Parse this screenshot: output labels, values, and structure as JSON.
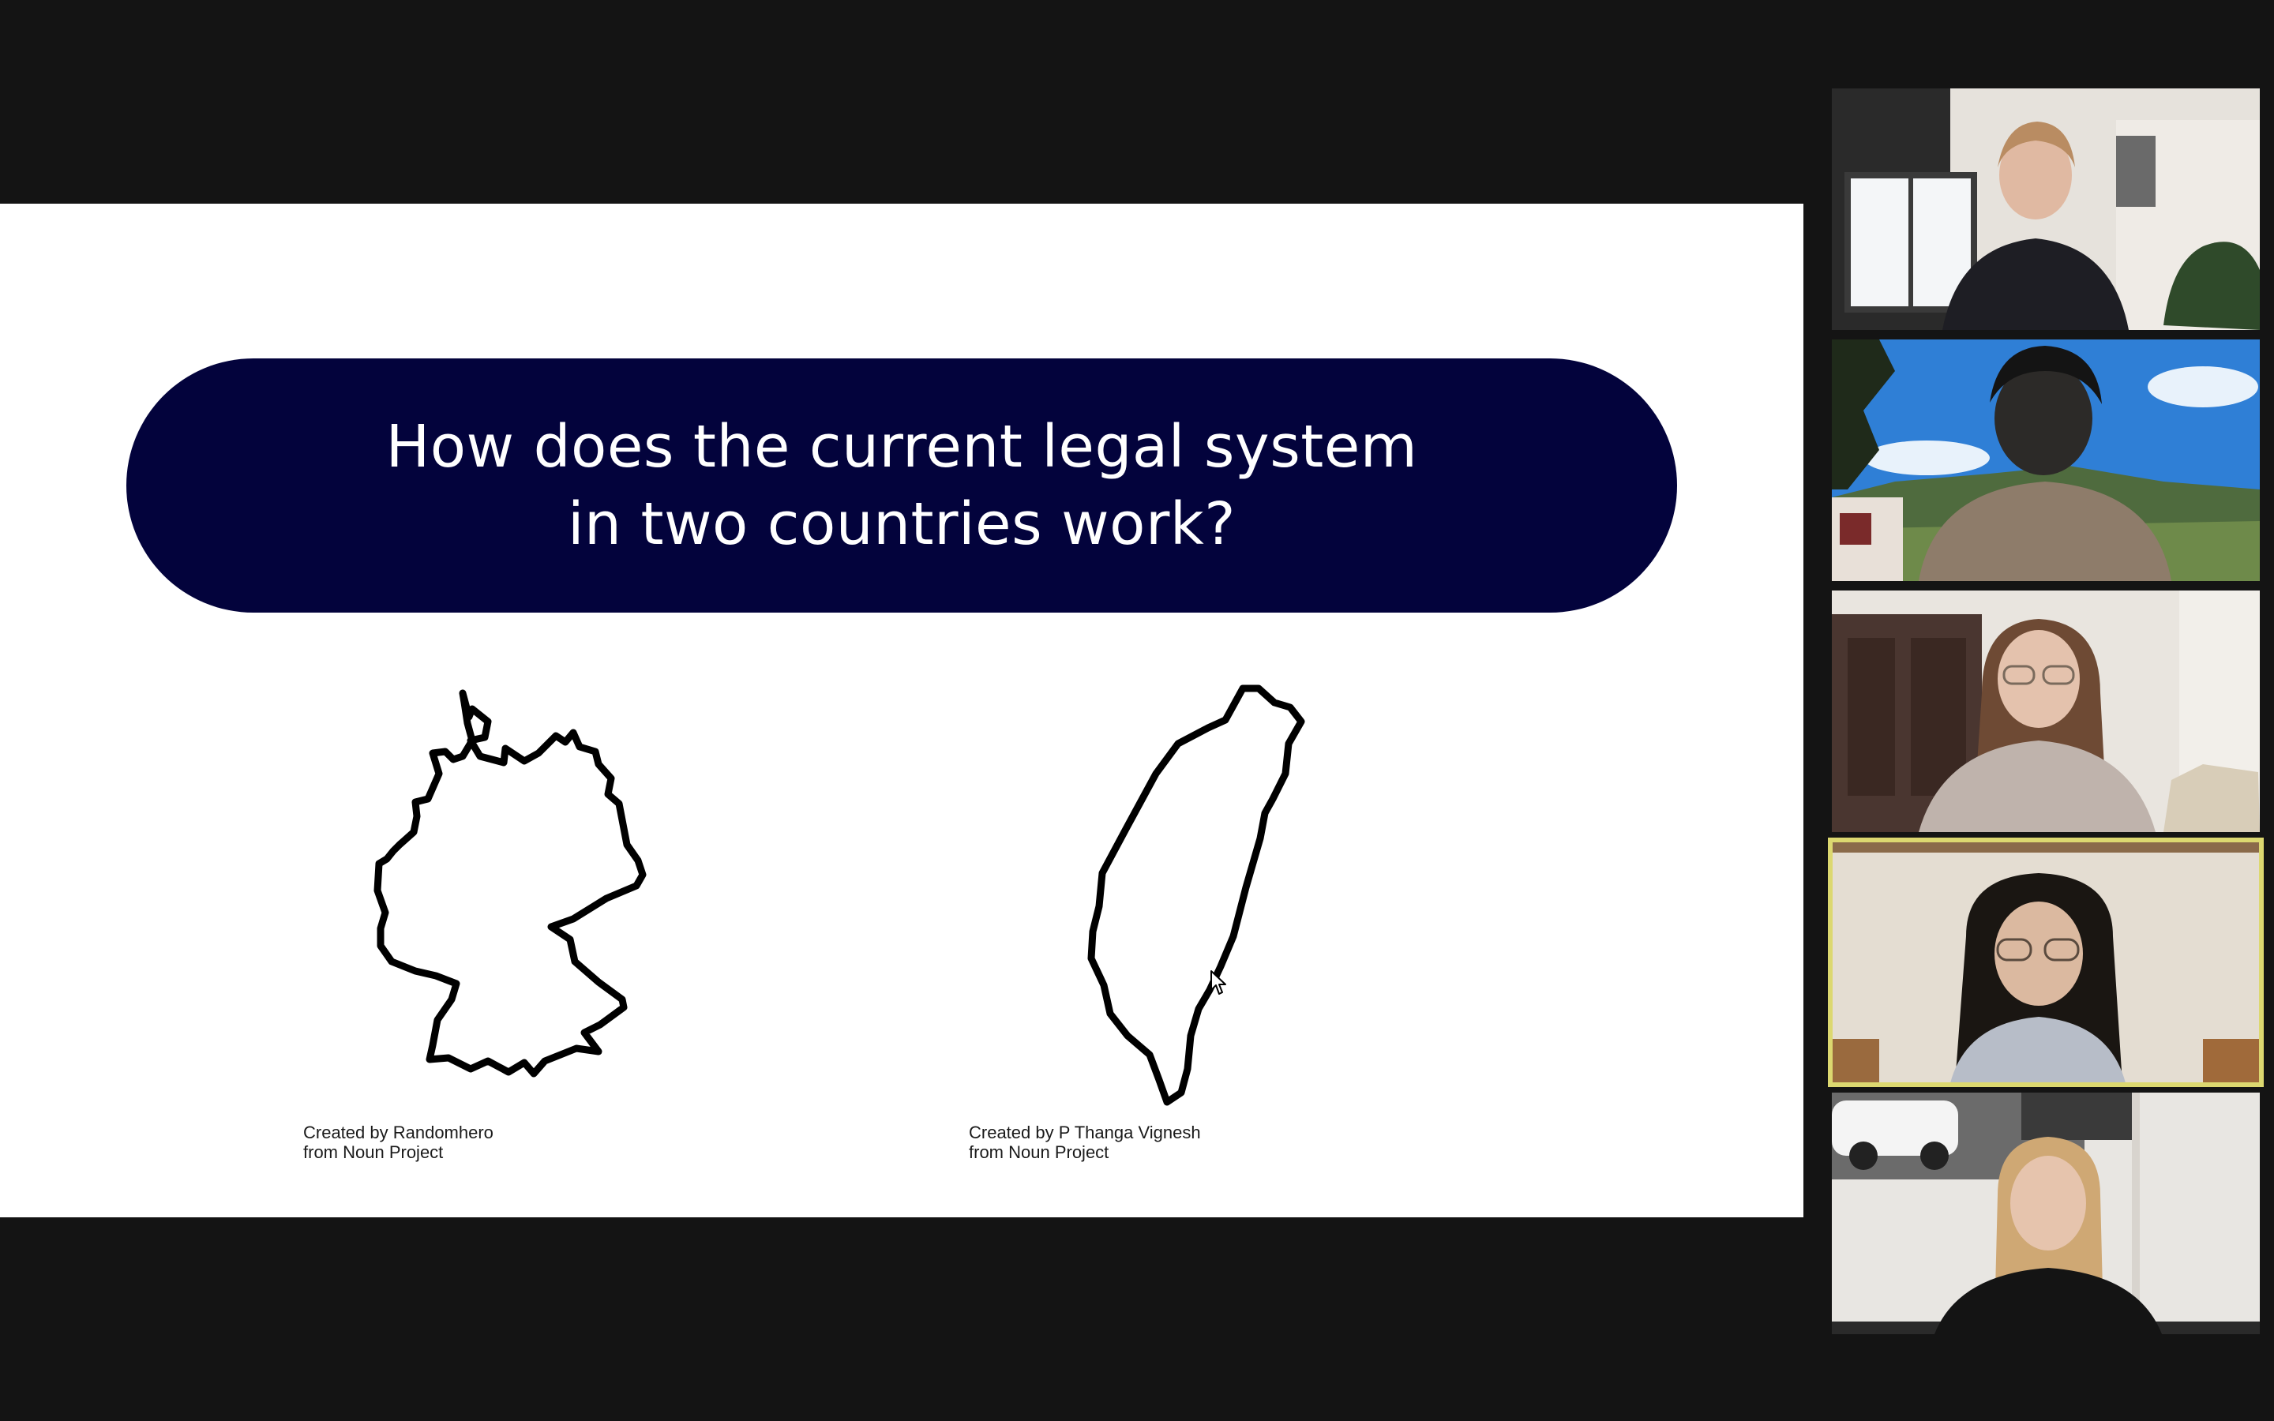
{
  "slide": {
    "title_line1": "How does the current legal system",
    "title_line2": "in two countries work?",
    "maps": [
      {
        "icon": "germany-outline-icon",
        "credit_line1": "Created by Randomhero",
        "credit_line2": "from Noun Project"
      },
      {
        "icon": "taiwan-outline-icon",
        "credit_line1": "Created by P Thanga Vignesh",
        "credit_line2": "from Noun Project"
      }
    ]
  },
  "gallery": {
    "active_speaker_index": 3,
    "active_border_color": "#dcd870",
    "tiles": [
      {
        "name": "participant-1"
      },
      {
        "name": "participant-2"
      },
      {
        "name": "participant-3"
      },
      {
        "name": "participant-4"
      },
      {
        "name": "participant-5"
      }
    ]
  },
  "colors": {
    "background": "#141414",
    "slide_background": "#ffffff",
    "title_pill": "#03033c"
  }
}
